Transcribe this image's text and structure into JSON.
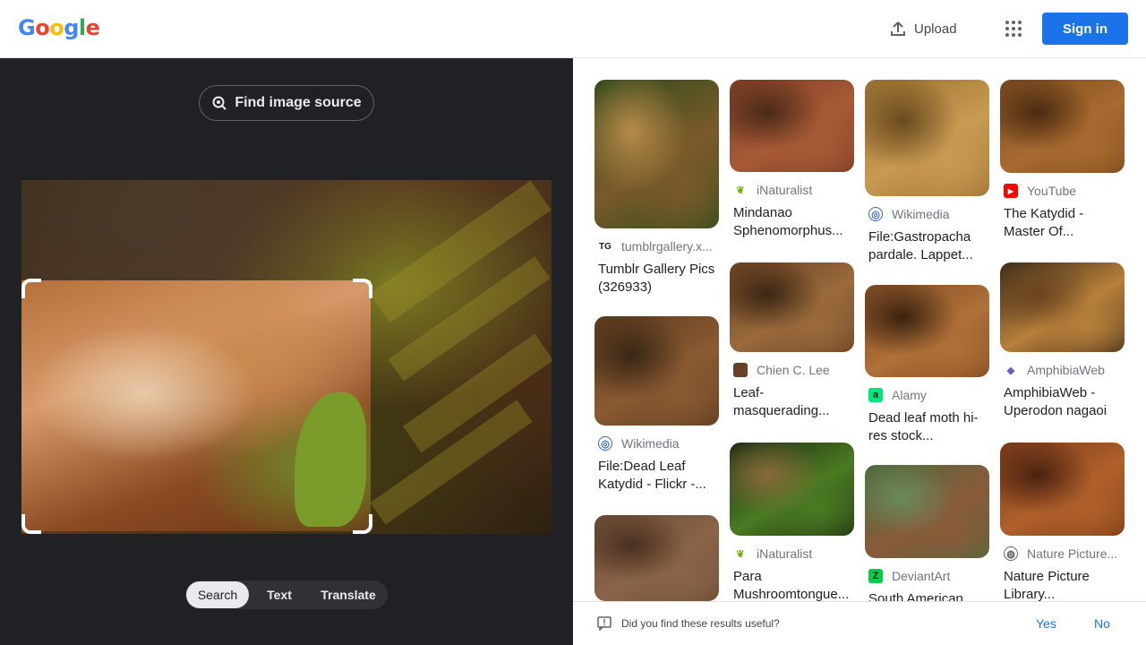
{
  "header": {
    "logo_letters": [
      {
        "ch": "G",
        "color": "#4285F4"
      },
      {
        "ch": "o",
        "color": "#EA4335"
      },
      {
        "ch": "o",
        "color": "#FBBC05"
      },
      {
        "ch": "g",
        "color": "#4285F4"
      },
      {
        "ch": "l",
        "color": "#34A853"
      },
      {
        "ch": "e",
        "color": "#EA4335"
      }
    ],
    "upload_label": "Upload",
    "signin_label": "Sign in"
  },
  "left_panel": {
    "find_source_label": "Find image source",
    "tabs": [
      "Search",
      "Text",
      "Translate"
    ],
    "active_tab": "Search"
  },
  "results": [
    {
      "col": 0,
      "source": "tumblrgallery.x...",
      "icon": "tg-icon",
      "title": "Tumblr Gallery Pics (326933)",
      "thumb_colors": [
        "#2f4a1a",
        "#7a5a2a",
        "#b58a4a"
      ]
    },
    {
      "col": 0,
      "source": "Wikimedia",
      "icon": "wikimedia-icon",
      "title": "File:Dead Leaf Katydid - Flickr -...",
      "thumb_colors": [
        "#5a3a1e",
        "#8a5a32",
        "#3a2614"
      ]
    },
    {
      "col": 0,
      "source": "",
      "icon": "",
      "title": "",
      "thumb_colors": [
        "#6a4a34",
        "#8a6448",
        "#4a3020"
      ]
    },
    {
      "col": 1,
      "source": "iNaturalist",
      "icon": "inaturalist-icon",
      "title": "Mindanao Sphenomorphus...",
      "thumb_colors": [
        "#7a3c22",
        "#a85a36",
        "#4a2a18"
      ]
    },
    {
      "col": 1,
      "source": "Chien C. Lee",
      "icon": "chien-icon",
      "title": "Leaf-masquerading...",
      "thumb_colors": [
        "#6a4022",
        "#9a6a3c",
        "#3a2614"
      ]
    },
    {
      "col": 1,
      "source": "iNaturalist",
      "icon": "inaturalist-icon",
      "title": "Para Mushroomtongue...",
      "thumb_colors": [
        "#1c2a14",
        "#4a7a22",
        "#8a6a3a"
      ]
    },
    {
      "col": 2,
      "source": "Wikimedia",
      "icon": "wikimedia-icon",
      "title": "File:Gastropacha pardale. Lappet...",
      "thumb_colors": [
        "#9a7030",
        "#c89a52",
        "#6a4a20"
      ]
    },
    {
      "col": 2,
      "source": "Alamy",
      "icon": "alamy-icon",
      "title": "Dead leaf moth hi-res stock...",
      "thumb_colors": [
        "#7a4a22",
        "#b07038",
        "#3a2210"
      ]
    },
    {
      "col": 2,
      "source": "DeviantArt",
      "icon": "deviantart-icon",
      "title": "South American...",
      "thumb_colors": [
        "#4a6a3a",
        "#8a5a3a",
        "#6a8a5a"
      ]
    },
    {
      "col": 3,
      "source": "YouTube",
      "icon": "youtube-icon",
      "title": "The Katydid - Master Of...",
      "thumb_colors": [
        "#7a4a1e",
        "#a86a30",
        "#4a2a10"
      ]
    },
    {
      "col": 3,
      "source": "AmphibiaWeb",
      "icon": "amphibiaweb-icon",
      "title": "AmphibiaWeb - Uperodon nagaoi",
      "thumb_colors": [
        "#3a2a1a",
        "#b8803a",
        "#6a4420"
      ]
    },
    {
      "col": 3,
      "source": "Nature Picture...",
      "icon": "globe-icon",
      "title": "Nature Picture Library...",
      "thumb_colors": [
        "#7a3a1a",
        "#b0602a",
        "#4a2210"
      ]
    }
  ],
  "footer": {
    "question": "Did you find these results useful?",
    "yes_label": "Yes",
    "no_label": "No"
  }
}
